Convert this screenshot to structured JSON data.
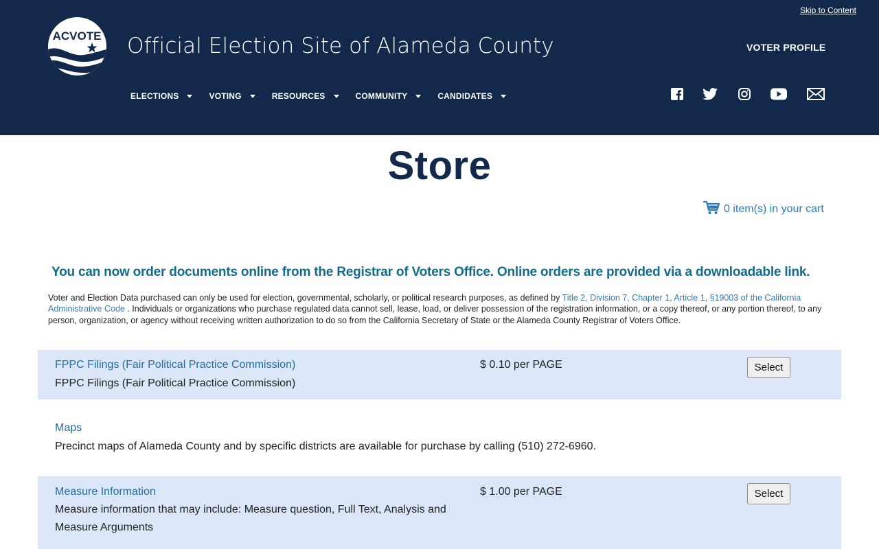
{
  "header": {
    "skip_link": "Skip to Content",
    "logo_text": "ACVOTE",
    "title": "Official Election Site of Alameda County",
    "voter_profile": "VOTER PROFILE",
    "nav": [
      "ELECTIONS",
      "VOTING",
      "RESOURCES",
      "COMMUNITY",
      "CANDIDATES"
    ],
    "social_icons": [
      "facebook-icon",
      "twitter-icon",
      "instagram-icon",
      "youtube-icon",
      "email-icon"
    ]
  },
  "page": {
    "title": "Store",
    "cart_text": "0 item(s) in your cart",
    "notice": "You can now order documents online from the Registrar of Voters Office. Online orders are provided via a downloadable link.",
    "disclaimer_before": "Voter and Election Data purchased can only be used for election, governmental, scholarly, or political research purposes, as defined by ",
    "disclaimer_link": "Title 2, Division 7, Chapter 1, Article 1, §19003 of the California Administrative Code",
    "disclaimer_after": " . Individuals or organizations who purchase regulated data cannot sell, lease, load, or deliver possession of the registration information, or a copy thereof, or any portion thereof, to any person, organization, or agency without receiving written authorization to do so from the California Secretary of State or the Alameda County Registrar of Voters Office."
  },
  "products": [
    {
      "name": "FPPC Filings (Fair Political Practice Commission)",
      "description": "FPPC Filings (Fair Political Practice Commission)",
      "price": "$ 0.10 per PAGE",
      "button": "Select"
    },
    {
      "name": "Maps",
      "description": "Precinct maps of Alameda County and by specific districts are available for purchase by calling (510) 272-6960."
    },
    {
      "name": "Measure Information",
      "description": "Measure information that may include: Measure question, Full Text, Analysis and Measure Arguments",
      "price": "$ 1.00 per PAGE",
      "button": "Select"
    }
  ],
  "colors": {
    "header_bg": "#13294b",
    "title_navy": "#13294b",
    "link_blue": "#2a7bbd",
    "notice_teal": "#146a8a",
    "row_highlight": "#dbe7f8"
  }
}
